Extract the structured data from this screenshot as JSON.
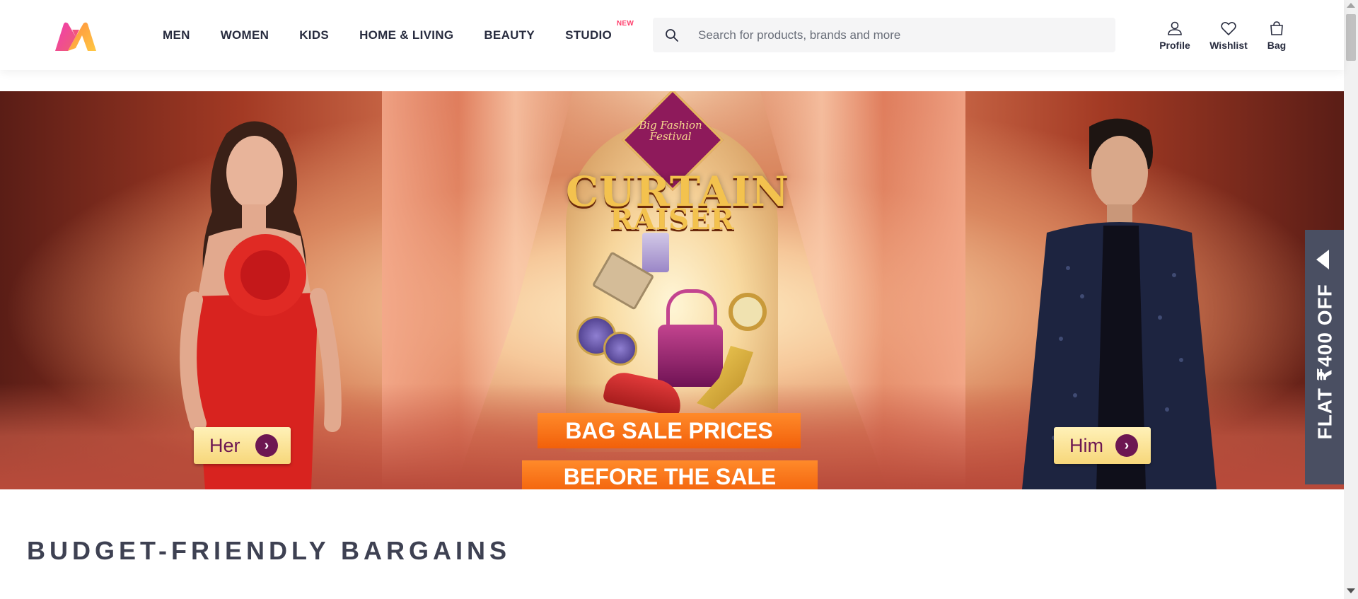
{
  "header": {
    "logo": "myntra-logo",
    "nav": [
      {
        "label": "MEN"
      },
      {
        "label": "WOMEN"
      },
      {
        "label": "KIDS"
      },
      {
        "label": "HOME & LIVING"
      },
      {
        "label": "BEAUTY"
      },
      {
        "label": "STUDIO",
        "badge": "NEW"
      }
    ],
    "search": {
      "placeholder": "Search for products, brands and more",
      "icon": "search-icon"
    },
    "actions": {
      "profile": {
        "label": "Profile",
        "icon": "user-icon"
      },
      "wishlist": {
        "label": "Wishlist",
        "icon": "heart-icon"
      },
      "bag": {
        "label": "Bag",
        "icon": "bag-icon"
      }
    }
  },
  "banner": {
    "badge": "Big Fashion Festival",
    "headline_line1": "CURTAIN",
    "headline_line2": "RAISER",
    "sale_line1": "BAG SALE PRICES",
    "sale_line2": "BEFORE THE SALE",
    "cta_her": "Her",
    "cta_him": "Him"
  },
  "offer_tab": {
    "text": "FLAT ₹400 OFF"
  },
  "section": {
    "title": "BUDGET-FRIENDLY BARGAINS"
  },
  "colors": {
    "brand_pink": "#ff3f6c",
    "text_dark": "#282c3f",
    "offer_tab_bg": "#4a4f62",
    "cta_purple": "#6d1752"
  }
}
